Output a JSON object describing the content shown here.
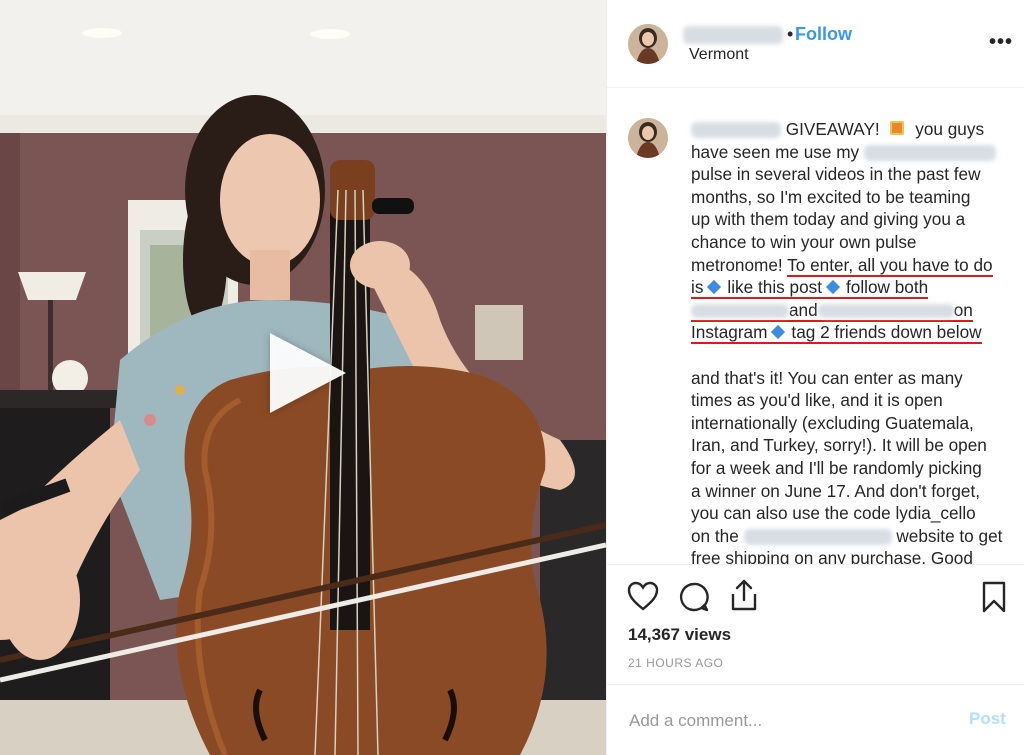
{
  "post": {
    "location": "Vermont",
    "follow_label": "Follow",
    "separator": "•",
    "more_label": "•••"
  },
  "caption": {
    "lines": [
      "GIVEAWAY!",
      "you guys",
      "have seen me use my",
      "pulse in several videos in the past few",
      "months, so I'm excited to be teaming",
      "up with them today and giving you a",
      "chance to win your own pulse",
      "metronome!",
      "To enter, all you have to do",
      "is",
      "like this post",
      "follow both",
      "and",
      "on",
      "Instagram",
      "tag 2 friends down below",
      "and that's it! You can enter as many",
      "times as you'd like, and it is open",
      "internationally (excluding Guatemala,",
      "Iran, and Turkey, sorry!). It will be open",
      "for a week and I'll be randomly picking",
      "a winner on June 17. And don't forget,",
      "you can also use the code lydia_cello",
      "on the",
      "website to get",
      "free shipping on any purchase. Good"
    ]
  },
  "stats": {
    "views": "14,367 views",
    "time_ago": "21 HOURS AGO"
  },
  "comment": {
    "placeholder": "Add a comment...",
    "post_label": "Post",
    "post_color": "#b2dffc"
  },
  "icons": [
    "play-icon",
    "heart-icon",
    "comment-icon",
    "share-icon",
    "bookmark-icon",
    "more-icon",
    "gift-icon",
    "diamond-icon"
  ],
  "colors": {
    "follow": "#3897f0",
    "underline": "#e01818",
    "diamond": "#3a8de0"
  }
}
